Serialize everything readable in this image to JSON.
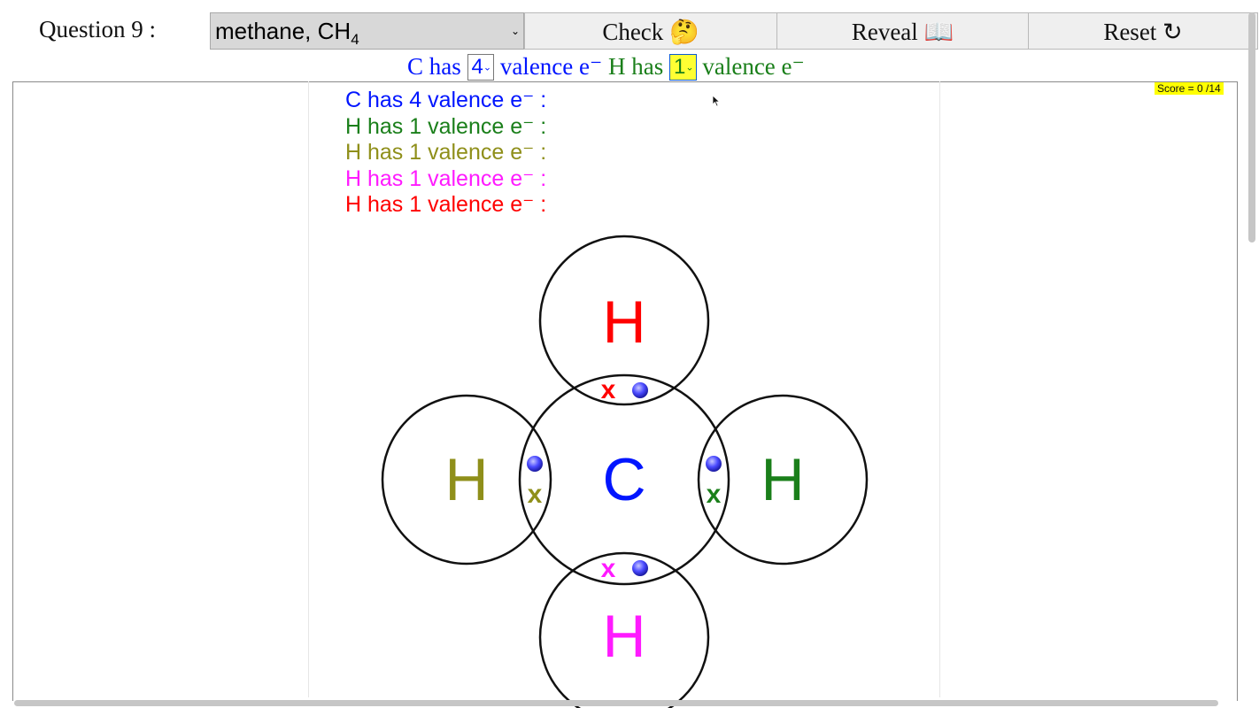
{
  "question_label": "Question 9 :",
  "molecule": {
    "name": "methane, CH",
    "subscript": "4"
  },
  "buttons": {
    "check": "Check 🤔",
    "reveal": "Reveal 📖",
    "reset": "Reset ↻"
  },
  "valence_row": {
    "c_prefix": "C has",
    "c_value": "4",
    "c_suffix": "valence e⁻",
    "h_prefix": "H has",
    "h_value": "1",
    "h_suffix": "valence e⁻"
  },
  "score": "Score = 0 /14",
  "valence_list": [
    {
      "text": "C has 4 valence e⁻ :",
      "color": "#0015ff"
    },
    {
      "text": "H has 1 valence e⁻ :",
      "color": "#1a7f1a"
    },
    {
      "text": "H has 1 valence e⁻ :",
      "color": "#8f8f1a"
    },
    {
      "text": "H has 1 valence e⁻ :",
      "color": "#ff1aff"
    },
    {
      "text": "H has 1 valence e⁻ :",
      "color": "#ff0000"
    }
  ],
  "atoms": {
    "center": {
      "symbol": "C",
      "color": "#0015ff"
    },
    "top": {
      "symbol": "H",
      "color": "#ff0000"
    },
    "left": {
      "symbol": "H",
      "color": "#8f8f1a"
    },
    "right": {
      "symbol": "H",
      "color": "#1a7f1a"
    },
    "bottom": {
      "symbol": "H",
      "color": "#ff1aff"
    }
  },
  "electron_marks": {
    "top_x": "x",
    "left_x": "x",
    "right_x": "x",
    "bottom_x": "x"
  },
  "dot_color": "#3b3bff"
}
